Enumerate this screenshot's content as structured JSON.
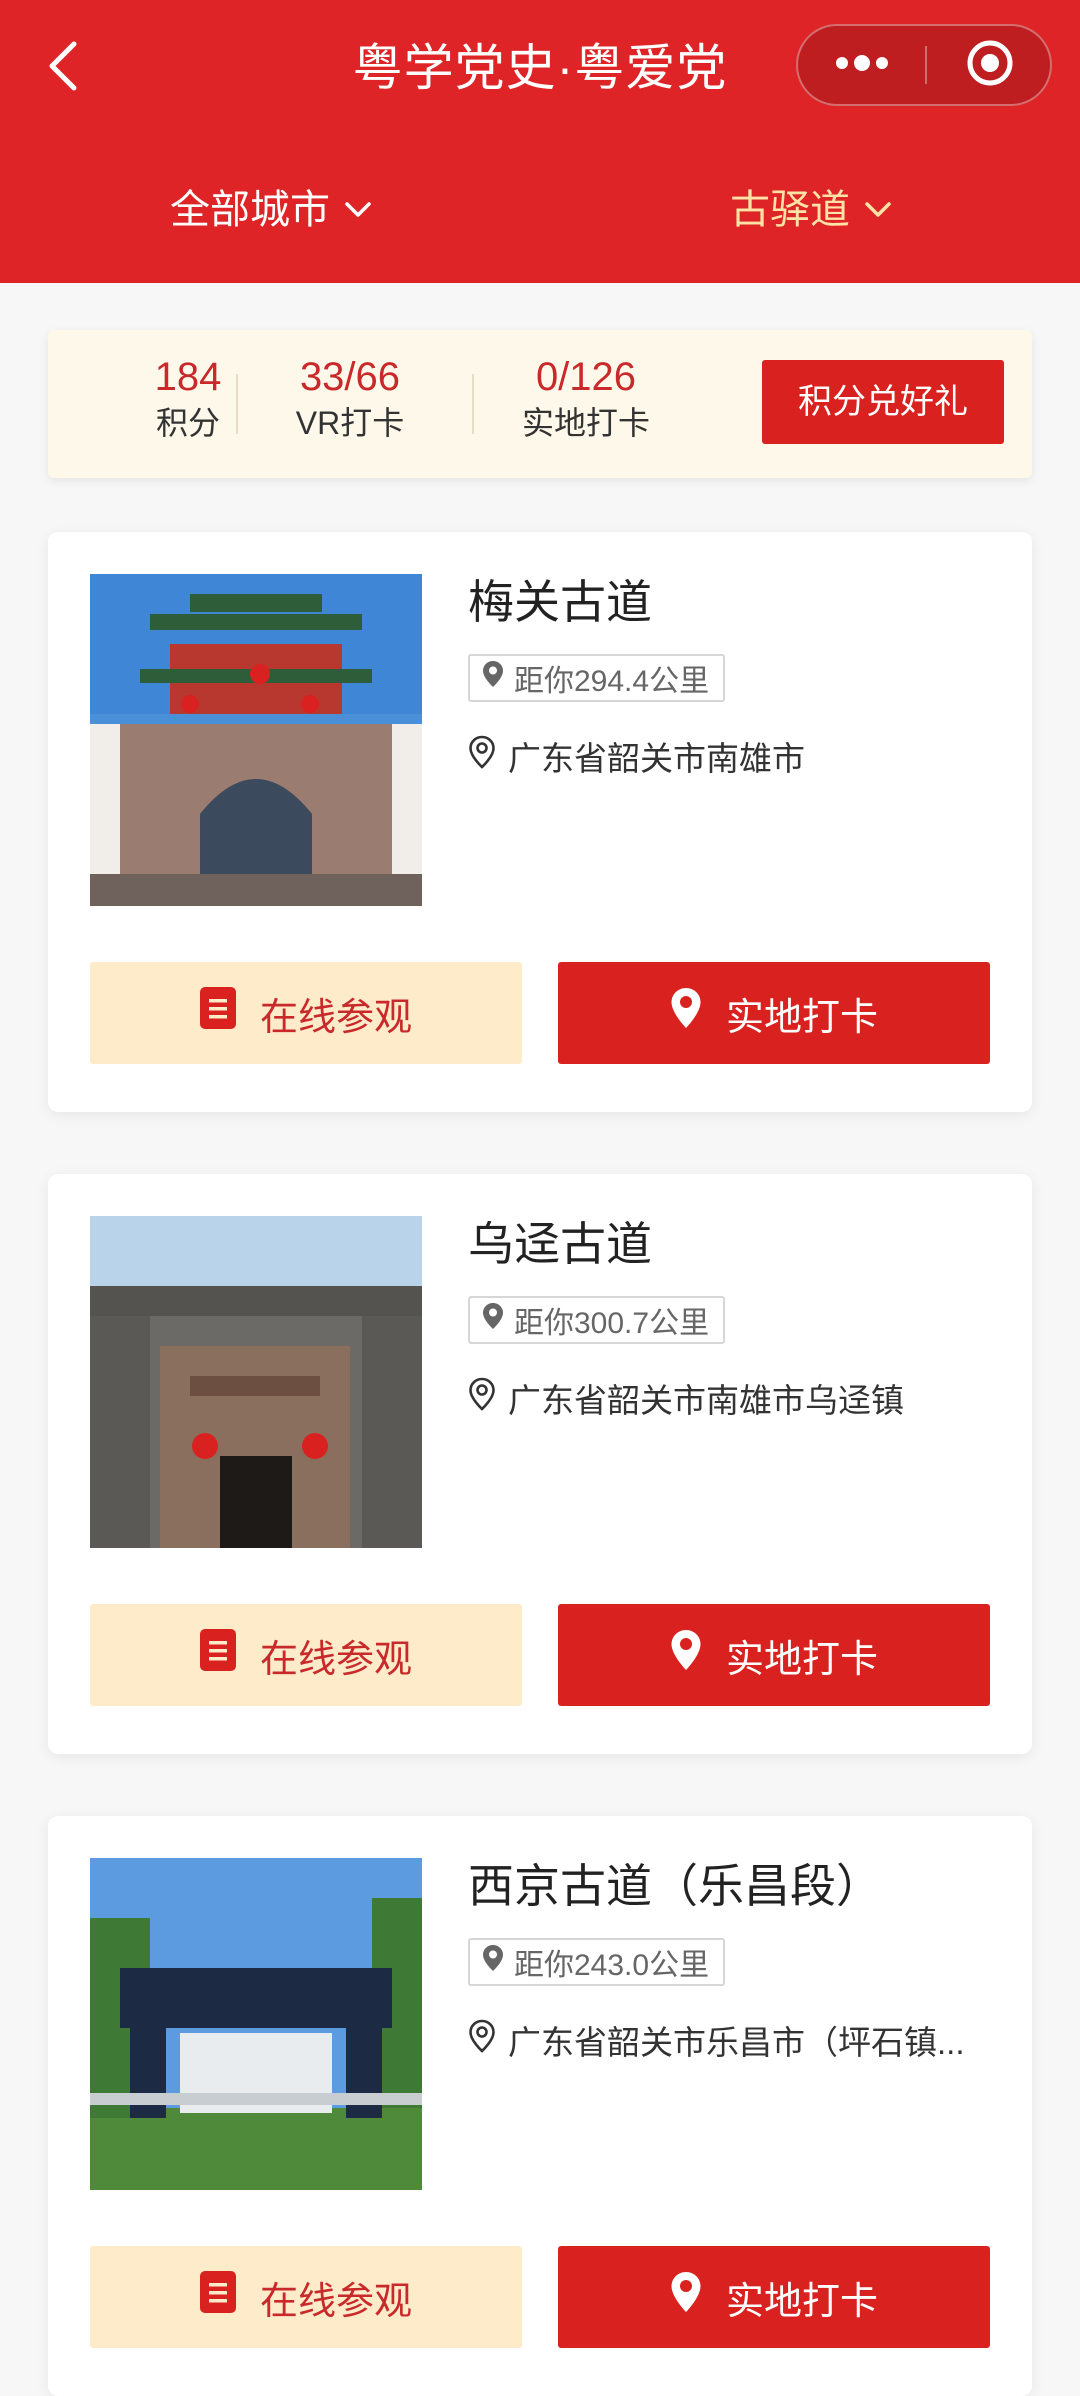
{
  "header": {
    "title": "粤学党史·粤爱党",
    "filters": {
      "city": "全部城市",
      "type": "古驿道"
    }
  },
  "stats": {
    "points": {
      "value": "184",
      "label": "积分"
    },
    "vr": {
      "value": "33/66",
      "label": "VR打卡"
    },
    "onsite": {
      "value": "0/126",
      "label": "实地打卡"
    },
    "redeem_label": "积分兑好礼"
  },
  "cards": [
    {
      "name": "梅关古道",
      "distance": "距你294.4公里",
      "address": "广东省韶关市南雄市",
      "visit_label": "在线参观",
      "checkin_label": "实地打卡"
    },
    {
      "name": "乌迳古道",
      "distance": "距你300.7公里",
      "address": "广东省韶关市南雄市乌迳镇",
      "visit_label": "在线参观",
      "checkin_label": "实地打卡"
    },
    {
      "name": "西京古道（乐昌段）",
      "distance": "距你243.0公里",
      "address": "广东省韶关市乐昌市（坪石镇...",
      "visit_label": "在线参观",
      "checkin_label": "实地打卡"
    }
  ],
  "colors": {
    "primary_red": "#de2426",
    "button_red": "#d9221f",
    "cream": "#fdebc9",
    "stat_bg": "#fdf8ea"
  },
  "icons": [
    "back-arrow-icon",
    "more-dots-icon",
    "close-target-icon",
    "chevron-down-icon",
    "location-pin-icon",
    "location-outline-icon",
    "document-icon"
  ]
}
